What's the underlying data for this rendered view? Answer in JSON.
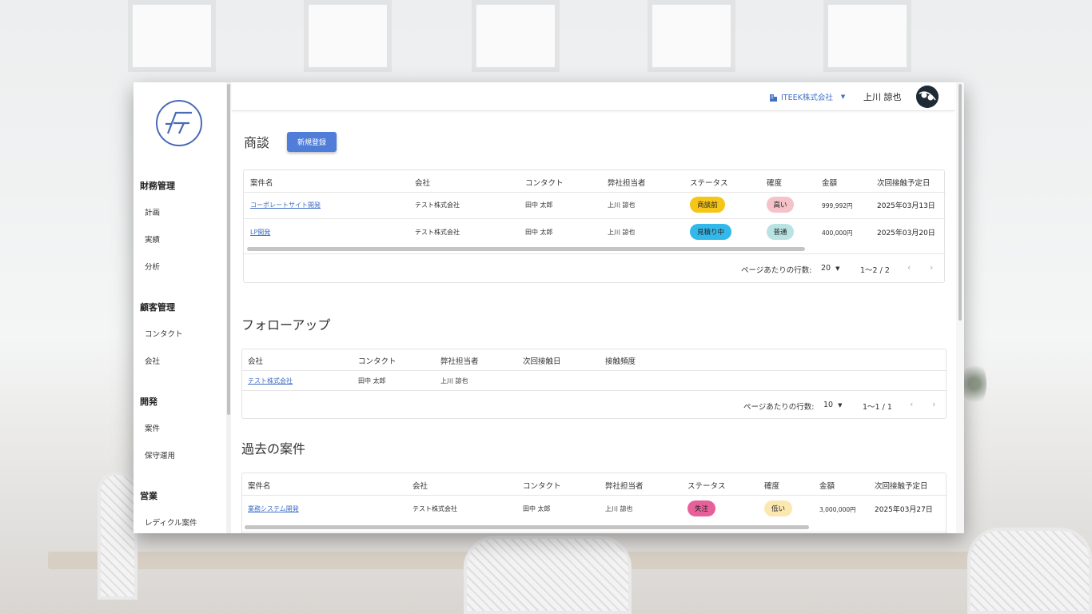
{
  "sidebar": {
    "sections": [
      {
        "title": "財務管理",
        "items": [
          "計画",
          "実績",
          "分析"
        ]
      },
      {
        "title": "顧客管理",
        "items": [
          "コンタクト",
          "会社"
        ]
      },
      {
        "title": "開発",
        "items": [
          "案件",
          "保守運用"
        ]
      },
      {
        "title": "営業",
        "items": [
          "レディクル案件"
        ]
      }
    ]
  },
  "topbar": {
    "company": "ITEEK株式会社",
    "user_name": "上川 諒也"
  },
  "deals": {
    "title": "商談",
    "new_button": "新規登録",
    "columns": [
      "案件名",
      "会社",
      "コンタクト",
      "弊社担当者",
      "ステータス",
      "確度",
      "金額",
      "次回接触予定日"
    ],
    "rows": [
      {
        "name": "コーポレートサイト開発",
        "company": "テスト株式会社",
        "contact": "田中 太郎",
        "owner": "上川 諒也",
        "status": "商談前",
        "status_color": "#f5c518",
        "confidence": "高い",
        "confidence_color": "#f4c2c8",
        "amount": "999,992円",
        "date": "2025年03月13日"
      },
      {
        "name": "LP開発",
        "company": "テスト株式会社",
        "contact": "田中 太郎",
        "owner": "上川 諒也",
        "status": "見積り中",
        "status_color": "#33b8ea",
        "confidence": "普通",
        "confidence_color": "#b9e3e3",
        "amount": "400,000円",
        "date": "2025年03月20日"
      }
    ],
    "pager": {
      "rows_label": "ページあたりの行数:",
      "rows_value": "20",
      "range": "1〜2 / 2"
    }
  },
  "followup": {
    "title": "フォローアップ",
    "columns": [
      "会社",
      "コンタクト",
      "弊社担当者",
      "次回接触日",
      "接触頻度"
    ],
    "rows": [
      {
        "company": "テスト株式会社",
        "contact": "田中 太郎",
        "owner": "上川 諒也"
      }
    ],
    "pager": {
      "rows_label": "ページあたりの行数:",
      "rows_value": "10",
      "range": "1〜1 / 1"
    }
  },
  "past": {
    "title": "過去の案件",
    "columns": [
      "案件名",
      "会社",
      "コンタクト",
      "弊社担当者",
      "ステータス",
      "確度",
      "金額",
      "次回接触予定日"
    ],
    "rows": [
      {
        "name": "業務システム開発",
        "company": "テスト株式会社",
        "contact": "田中 太郎",
        "owner": "上川 諒也",
        "status": "失注",
        "status_color": "#e8609a",
        "confidence": "低い",
        "confidence_color": "#fbe7b0",
        "amount": "3,000,000円",
        "date": "2025年03月27日"
      }
    ]
  },
  "icons": {
    "company": "building-icon",
    "dropdown": "caret-down-icon",
    "prev": "chevron-left-icon",
    "next": "chevron-right-icon"
  },
  "colors": {
    "accent": "#4f7dd8",
    "link": "#3f6fc4"
  }
}
